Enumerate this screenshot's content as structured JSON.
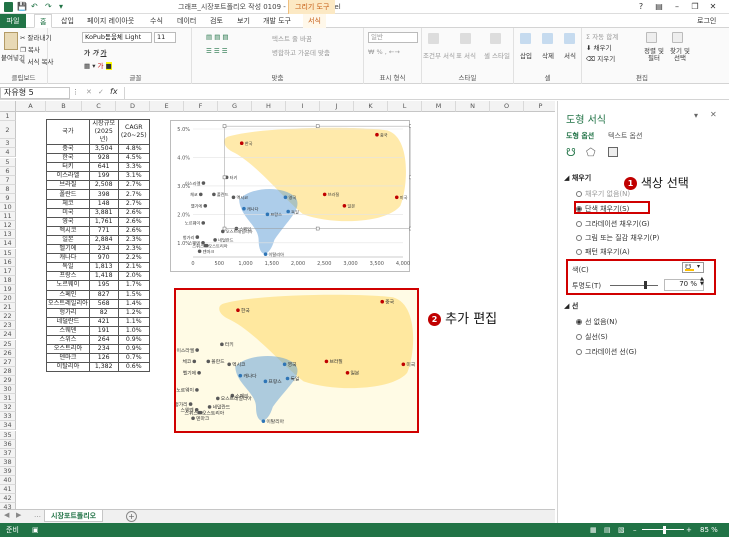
{
  "window": {
    "title": "그래프_시장포트폴리오 작성 0109 - Microsoft Excel",
    "context_tool": "그리기 도구",
    "help": "?",
    "login": "로그인"
  },
  "ribbon_tabs": [
    "파일",
    "홈",
    "삽입",
    "페이지 레이아웃",
    "수식",
    "데이터",
    "검토",
    "보기",
    "개발 도구",
    "서식"
  ],
  "ribbon": {
    "clipboard": {
      "paste": "붙여넣기",
      "cut": "잘라내기",
      "copy": "복사",
      "format_painter": "서식 복사",
      "label": "클립보드"
    },
    "font": {
      "name": "KoPub돋움체 Light",
      "size": "11",
      "label": "글꼴"
    },
    "alignment": {
      "wrap": "텍스트 줄 바꿈",
      "merge": "병합하고 가운데 맞춤",
      "label": "맞춤"
    },
    "number": {
      "format": "일반",
      "label": "표시 형식"
    },
    "styles": {
      "conditional": "조건부 서식",
      "table": "표 서식",
      "cell": "셀 스타일",
      "label": "스타일"
    },
    "cells": {
      "insert": "삽입",
      "delete": "삭제",
      "format": "서식",
      "label": "셀"
    },
    "editing": {
      "autosum": "자동 합계",
      "fill": "채우기",
      "clear": "지우기",
      "sort": "정렬 및 필터",
      "find": "찾기 및 선택",
      "label": "편집"
    }
  },
  "formula_bar": {
    "name_box": "자유형 5",
    "fx": "fx"
  },
  "columns": [
    "A",
    "B",
    "C",
    "D",
    "E",
    "F",
    "G",
    "H",
    "I",
    "J",
    "K",
    "L",
    "M",
    "N",
    "O",
    "P",
    "Q"
  ],
  "rows": [
    "1",
    "2",
    "3",
    "4",
    "5",
    "6",
    "7",
    "8",
    "9",
    "10",
    "11",
    "12",
    "13",
    "14",
    "15",
    "16",
    "17",
    "18",
    "19",
    "20",
    "21",
    "22",
    "23",
    "24",
    "25",
    "26",
    "27",
    "28",
    "29",
    "30",
    "31",
    "32",
    "33",
    "34",
    "35",
    "36",
    "37",
    "38",
    "39",
    "40",
    "41",
    "42",
    "43",
    "44"
  ],
  "table": {
    "headers": [
      "국가",
      "시장규모\n(2025년)",
      "CAGR\n(20~25)"
    ],
    "rows": [
      [
        "중국",
        "3,504",
        "4.8%"
      ],
      [
        "한국",
        "928",
        "4.5%"
      ],
      [
        "터키",
        "641",
        "3.3%"
      ],
      [
        "이스라엘",
        "199",
        "3.1%"
      ],
      [
        "브라질",
        "2,508",
        "2.7%"
      ],
      [
        "폴란드",
        "398",
        "2.7%"
      ],
      [
        "체코",
        "148",
        "2.7%"
      ],
      [
        "미국",
        "3,881",
        "2.6%"
      ],
      [
        "영국",
        "1,761",
        "2.6%"
      ],
      [
        "멕시코",
        "771",
        "2.6%"
      ],
      [
        "일본",
        "2,884",
        "2.3%"
      ],
      [
        "벨기에",
        "234",
        "2.3%"
      ],
      [
        "캐나다",
        "970",
        "2.2%"
      ],
      [
        "독일",
        "1,813",
        "2.1%"
      ],
      [
        "프랑스",
        "1,418",
        "2.0%"
      ],
      [
        "노르웨이",
        "195",
        "1.7%"
      ],
      [
        "스페인",
        "827",
        "1.5%"
      ],
      [
        "오스트레일리아",
        "568",
        "1.4%"
      ],
      [
        "헝가리",
        "82",
        "1.2%"
      ],
      [
        "네덜란드",
        "421",
        "1.1%"
      ],
      [
        "스웨덴",
        "191",
        "1.0%"
      ],
      [
        "스위스",
        "264",
        "0.9%"
      ],
      [
        "오스트리아",
        "234",
        "0.9%"
      ],
      [
        "덴마크",
        "126",
        "0.7%"
      ],
      [
        "이탈리아",
        "1,382",
        "0.6%"
      ]
    ]
  },
  "chart_data": {
    "type": "scatter",
    "x_ticks": [
      "0",
      "500",
      "1,000",
      "1,500",
      "2,000",
      "2,500",
      "3,000",
      "3,500",
      "4,000"
    ],
    "y_ticks": [
      "1.0%",
      "2.0%",
      "3.0%",
      "4.0%",
      "5.0%"
    ],
    "xlim": [
      0,
      4000
    ],
    "ylim": [
      0.5,
      5.0
    ],
    "colors": {
      "red": "#c00000",
      "blue": "#2e75b6",
      "gray": "#595959",
      "yellow_fill": "#ffd966",
      "blue_fill": "#5b9bd5",
      "bg": "#fffbe5"
    },
    "points": [
      {
        "label": "중국",
        "x": 3504,
        "y": 4.8,
        "color": "red"
      },
      {
        "label": "한국",
        "x": 928,
        "y": 4.5,
        "color": "red"
      },
      {
        "label": "터키",
        "x": 641,
        "y": 3.3,
        "color": "gray"
      },
      {
        "label": "이스라엘",
        "x": 199,
        "y": 3.1,
        "color": "gray"
      },
      {
        "label": "브라질",
        "x": 2508,
        "y": 2.7,
        "color": "red"
      },
      {
        "label": "폴란드",
        "x": 398,
        "y": 2.7,
        "color": "gray"
      },
      {
        "label": "체코",
        "x": 148,
        "y": 2.7,
        "color": "gray"
      },
      {
        "label": "미국",
        "x": 3881,
        "y": 2.6,
        "color": "red"
      },
      {
        "label": "영국",
        "x": 1761,
        "y": 2.6,
        "color": "blue"
      },
      {
        "label": "멕시코",
        "x": 771,
        "y": 2.6,
        "color": "gray"
      },
      {
        "label": "일본",
        "x": 2884,
        "y": 2.3,
        "color": "red"
      },
      {
        "label": "벨기에",
        "x": 234,
        "y": 2.3,
        "color": "gray"
      },
      {
        "label": "캐나다",
        "x": 970,
        "y": 2.2,
        "color": "blue"
      },
      {
        "label": "독일",
        "x": 1813,
        "y": 2.1,
        "color": "blue"
      },
      {
        "label": "프랑스",
        "x": 1418,
        "y": 2.0,
        "color": "blue"
      },
      {
        "label": "노르웨이",
        "x": 195,
        "y": 1.7,
        "color": "gray"
      },
      {
        "label": "스페인",
        "x": 827,
        "y": 1.5,
        "color": "gray"
      },
      {
        "label": "오스트레일리아",
        "x": 568,
        "y": 1.4,
        "color": "gray"
      },
      {
        "label": "헝가리",
        "x": 82,
        "y": 1.2,
        "color": "gray"
      },
      {
        "label": "네덜란드",
        "x": 421,
        "y": 1.1,
        "color": "gray"
      },
      {
        "label": "스웨덴",
        "x": 191,
        "y": 1.0,
        "color": "gray"
      },
      {
        "label": "스위스",
        "x": 264,
        "y": 0.9,
        "color": "gray"
      },
      {
        "label": "오스트리아",
        "x": 234,
        "y": 0.9,
        "color": "gray"
      },
      {
        "label": "덴마크",
        "x": 126,
        "y": 0.7,
        "color": "gray"
      },
      {
        "label": "이탈리아",
        "x": 1382,
        "y": 0.6,
        "color": "blue"
      }
    ]
  },
  "sheet_tabs": {
    "active": "시장포트폴리오",
    "add": "+"
  },
  "status": {
    "ready": "준비",
    "zoom": "85 %"
  },
  "pane": {
    "title": "도형 서식",
    "tab_shape": "도형 옵션",
    "tab_text": "텍스트 옵션",
    "fill_section": "채우기",
    "fill_options": [
      "채우기 없음(N)",
      "단색 채우기(S)",
      "그라데이션 채우기(G)",
      "그림 또는 질감 채우기(P)",
      "패턴 채우기(A)"
    ],
    "color_label": "색(C)",
    "transparency_label": "투명도(T)",
    "transparency_value": "70 %",
    "transparency": 0.7,
    "line_section": "선",
    "line_options": [
      "선 없음(N)",
      "실선(S)",
      "그라데이션 선(G)"
    ]
  },
  "annotations": {
    "step1_num": "1",
    "step1": "색상 선택",
    "step2_num": "2",
    "step2": "추가 편집"
  }
}
